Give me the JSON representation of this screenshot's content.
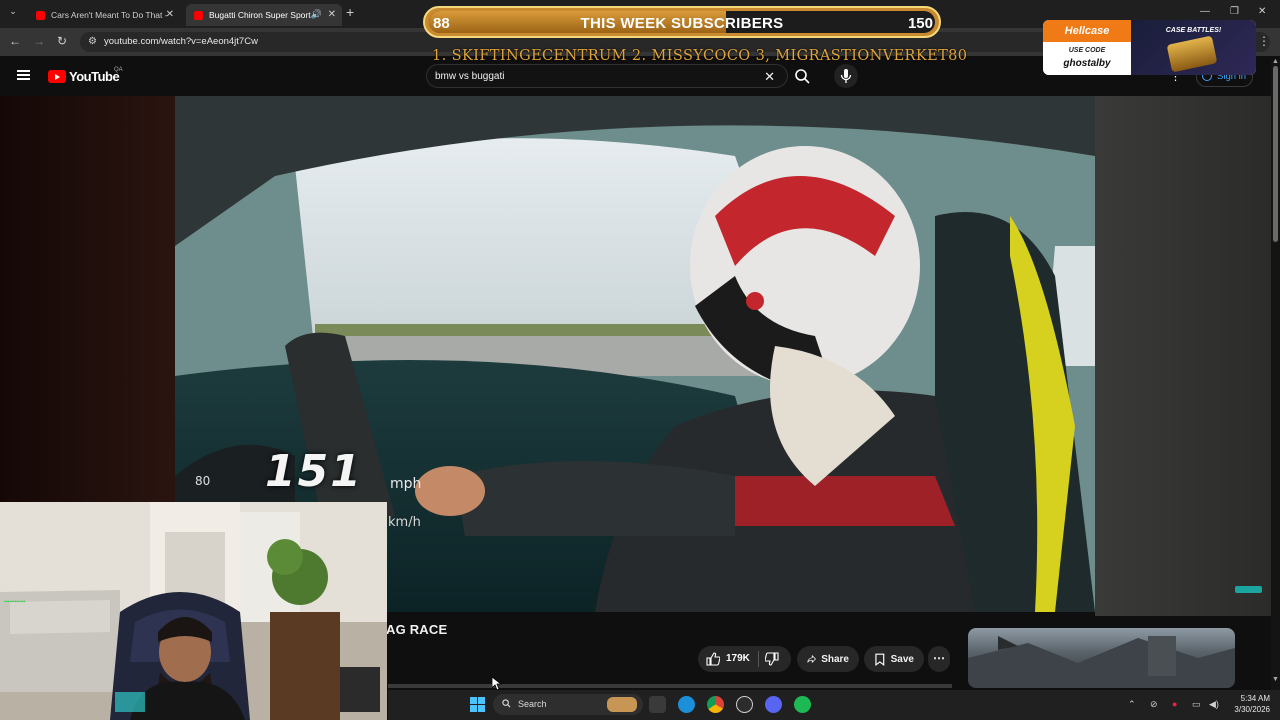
{
  "browser": {
    "tabs": [
      {
        "title": "Cars Aren't Meant To Do That -",
        "active": false
      },
      {
        "title": "Bugatti Chiron Super Sport",
        "active": true
      }
    ],
    "url": "youtube.com/watch?v=eAeon4jt7Cw"
  },
  "youtube": {
    "logo_text": "YouTube",
    "region": "QA",
    "search_query": "bmw vs buggati",
    "sign_in": "Sign in"
  },
  "video": {
    "speed_value": "151",
    "speed_unit": "mph",
    "speed_unit_alt": "km/h",
    "dial_mark": "80",
    "title_visible": "AG RACE",
    "likes": "179K",
    "share": "Share",
    "save": "Save"
  },
  "overlay": {
    "subscribers": {
      "current": "88",
      "label": "THIS WEEK SUBSCRIBERS",
      "goal": "150",
      "progress": 0.587
    },
    "top_subs": "1. SKIFTINGECENTRUM  2. MISSYCOCO  3, MIGRASTIONVERKET80",
    "promo": {
      "brand": "Hellcase",
      "use_code_label": "USE CODE",
      "code": "ghostalby",
      "case_battles": "CASE BATTLES!"
    }
  },
  "taskbar": {
    "search_label": "Search",
    "time": "5:34 AM",
    "date": "3/30/2026"
  },
  "colors": {
    "yt_red": "#ff0000",
    "link_blue": "#3ea6ff",
    "overlay_gold": "#e0a43a",
    "promo_orange": "#f07a16"
  }
}
